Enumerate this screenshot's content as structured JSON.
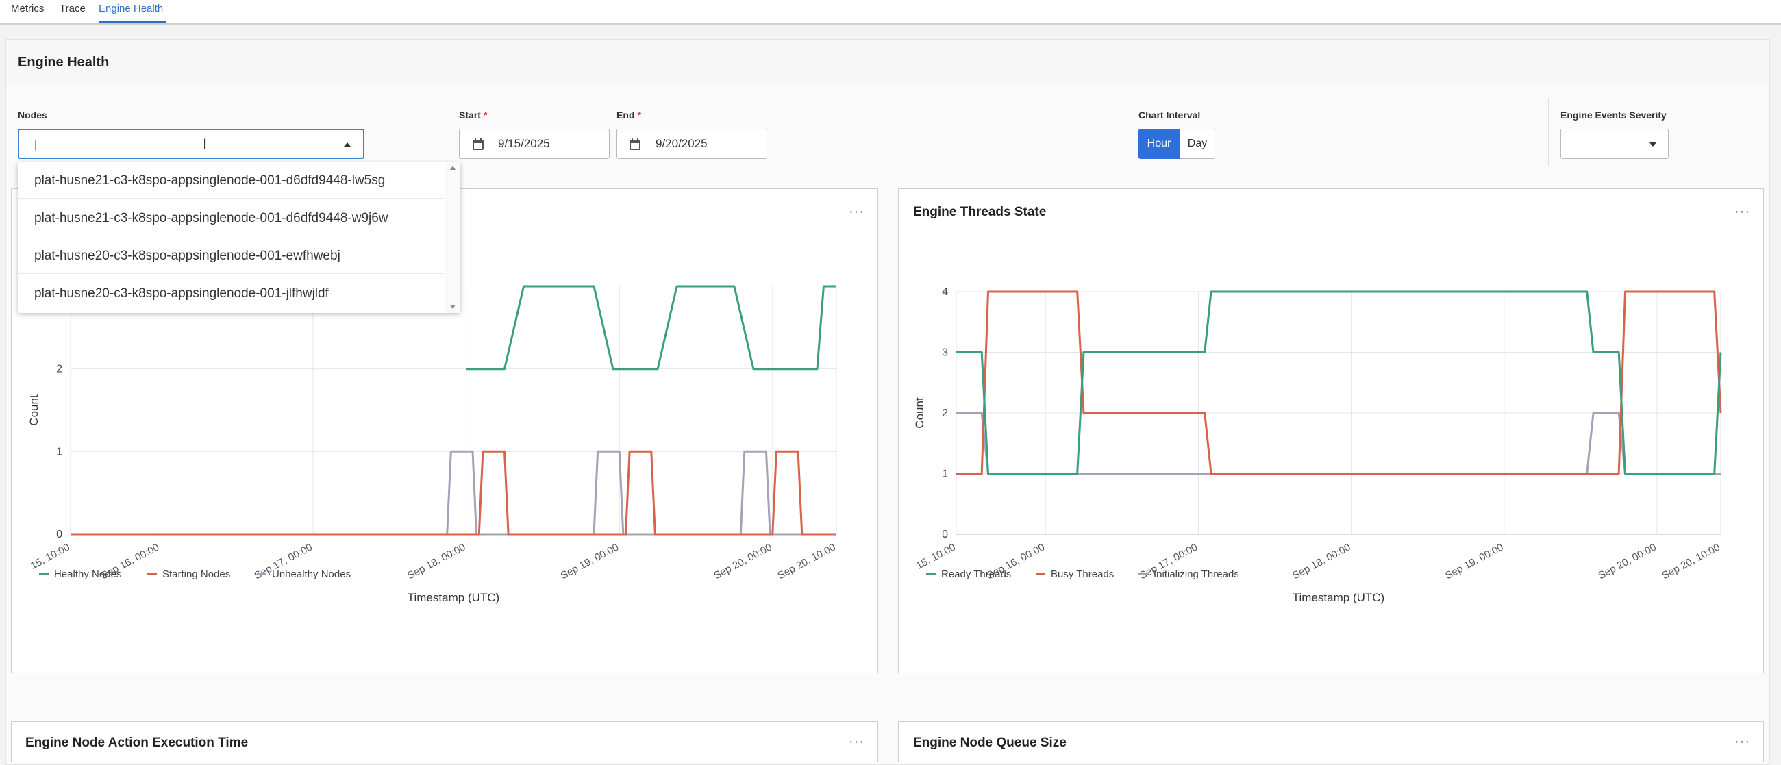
{
  "tabs": [
    {
      "label": "Metrics"
    },
    {
      "label": "Trace"
    },
    {
      "label": "Engine Health"
    }
  ],
  "page_title": "Engine Health",
  "filters": {
    "nodes_label": "Nodes",
    "nodes_value": "|",
    "start_label": "Start",
    "start_value": "9/15/2025",
    "end_label": "End",
    "end_value": "9/20/2025",
    "required_mark": "*",
    "interval_label": "Chart Interval",
    "interval_hour": "Hour",
    "interval_day": "Day",
    "interval_selected": "Hour",
    "severity_label": "Engine Events Severity",
    "severity_value": ""
  },
  "node_options": [
    "plat-husne21-c3-k8spo-appsinglenode-001-d6dfd9448-lw5sg",
    "plat-husne21-c3-k8spo-appsinglenode-001-d6dfd9448-w9j6w",
    "plat-husne20-c3-k8spo-appsinglenode-001-ewfhwebj",
    "plat-husne20-c3-k8spo-appsinglenode-001-jlfhwjldf"
  ],
  "panels": {
    "threads_title": "Engine Threads State",
    "exec_title": "Engine Node Action Execution Time",
    "queue_title": "Engine Node Queue Size",
    "more_label": "···"
  },
  "colors": {
    "accent": "#2f6fdc",
    "green": "#3a9e82",
    "red": "#d9624a",
    "gray": "#a3a3b8"
  },
  "chart_data": [
    {
      "type": "line",
      "xlabel": "Timestamp (UTC)",
      "ylabel": "Count",
      "x_ticks": [
        "15, 10:00",
        "Sep 16, 00:00",
        "Sep 17, 00:00",
        "Sep 18, 00:00",
        "Sep 19, 00:00",
        "Sep 20, 00:00",
        "Sep 20, 10:00"
      ],
      "y_ticks": [
        0,
        1,
        2
      ],
      "ylim": [
        0,
        3
      ],
      "x_range_hours": [
        0,
        120
      ],
      "series": [
        {
          "name": "Healthy Nodes",
          "color": "#3a9e82",
          "points": [
            [
              62,
              2.0
            ],
            [
              68,
              2.0
            ],
            [
              71,
              3.0
            ],
            [
              82,
              3.0
            ],
            [
              85,
              2.0
            ],
            [
              92,
              2.0
            ],
            [
              95,
              3.0
            ],
            [
              104,
              3.0
            ],
            [
              107,
              2.0
            ],
            [
              117,
              2.0
            ],
            [
              118,
              3.0
            ],
            [
              120,
              3.0
            ]
          ]
        },
        {
          "name": "Starting Nodes",
          "color": "#d9624a",
          "points": [
            [
              0,
              0
            ],
            [
              64,
              0
            ],
            [
              64.6,
              1
            ],
            [
              68,
              1
            ],
            [
              68.6,
              0
            ],
            [
              87,
              0
            ],
            [
              87.6,
              1
            ],
            [
              91,
              1
            ],
            [
              91.6,
              0
            ],
            [
              110,
              0
            ],
            [
              110.6,
              1
            ],
            [
              114,
              1
            ],
            [
              114.6,
              0
            ],
            [
              120,
              0
            ]
          ]
        },
        {
          "name": "Unhealthy Nodes",
          "color": "#a3a3b8",
          "points": [
            [
              0,
              0
            ],
            [
              59,
              0
            ],
            [
              59.6,
              1
            ],
            [
              63,
              1
            ],
            [
              63.6,
              0
            ],
            [
              82,
              0
            ],
            [
              82.6,
              1
            ],
            [
              86,
              1
            ],
            [
              86.6,
              0
            ],
            [
              105,
              0
            ],
            [
              105.6,
              1
            ],
            [
              109,
              1
            ],
            [
              109.6,
              0
            ],
            [
              120,
              0
            ]
          ]
        }
      ]
    },
    {
      "type": "line",
      "title": "Engine Threads State",
      "xlabel": "Timestamp (UTC)",
      "ylabel": "Count",
      "x_ticks": [
        "15, 10:00",
        "Sep 16, 00:00",
        "Sep 17, 00:00",
        "Sep 18, 00:00",
        "Sep 19, 00:00",
        "Sep 20, 00:00",
        "Sep 20, 10:00"
      ],
      "y_ticks": [
        0,
        1,
        2,
        3,
        4
      ],
      "ylim": [
        0,
        4
      ],
      "x_range_hours": [
        0,
        120
      ],
      "series": [
        {
          "name": "Ready Threads",
          "color": "#3a9e82",
          "points": [
            [
              0,
              3
            ],
            [
              4,
              3
            ],
            [
              5,
              1
            ],
            [
              19,
              1
            ],
            [
              20,
              3
            ],
            [
              39,
              3
            ],
            [
              40,
              4
            ],
            [
              99,
              4
            ],
            [
              100,
              3
            ],
            [
              104,
              3
            ],
            [
              105,
              1
            ],
            [
              119,
              1
            ],
            [
              120,
              3
            ]
          ]
        },
        {
          "name": "Busy Threads",
          "color": "#d9624a",
          "points": [
            [
              0,
              1
            ],
            [
              4,
              1
            ],
            [
              5,
              4
            ],
            [
              19,
              4
            ],
            [
              20,
              2
            ],
            [
              39,
              2
            ],
            [
              40,
              1
            ],
            [
              99,
              1
            ],
            [
              104,
              1
            ],
            [
              105,
              4
            ],
            [
              119,
              4
            ],
            [
              120,
              2
            ]
          ]
        },
        {
          "name": "Initializing Threads",
          "color": "#a3a3b8",
          "points": [
            [
              0,
              2
            ],
            [
              4,
              2
            ],
            [
              5,
              1
            ],
            [
              99,
              1
            ],
            [
              100,
              2
            ],
            [
              104,
              2
            ],
            [
              105,
              1
            ],
            [
              120,
              1
            ]
          ]
        }
      ]
    }
  ]
}
